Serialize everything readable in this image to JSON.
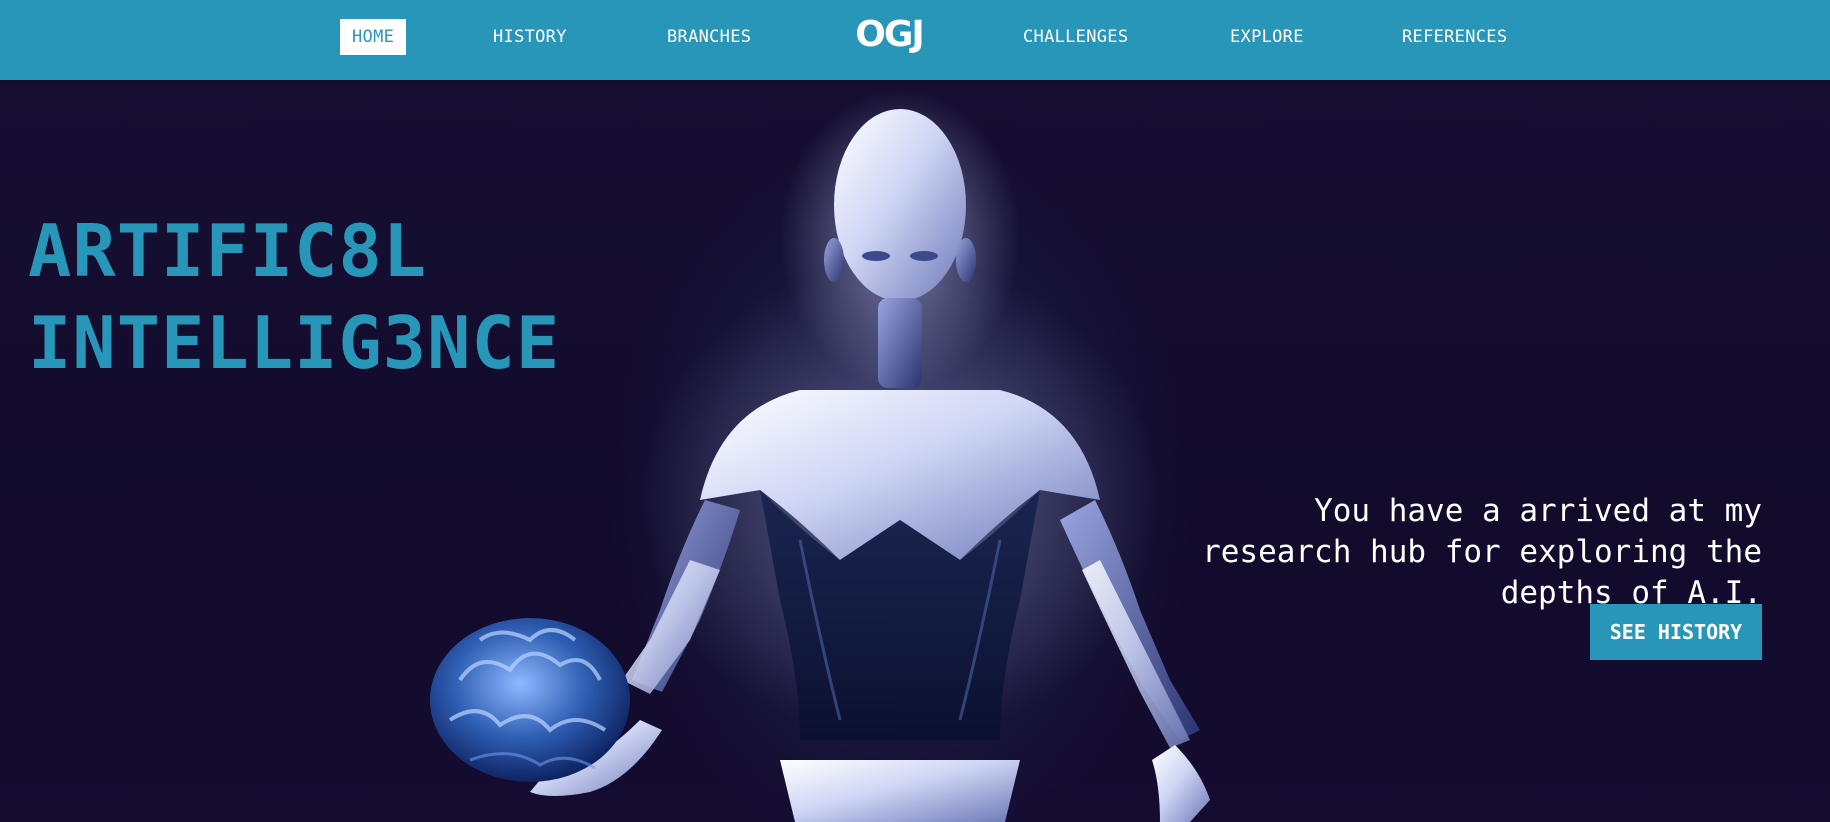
{
  "nav": {
    "items": [
      {
        "label": "HOME",
        "active": true
      },
      {
        "label": "HISTORY",
        "active": false
      },
      {
        "label": "BRANCHES",
        "active": false
      },
      {
        "label": "CHALLENGES",
        "active": false
      },
      {
        "label": "EXPLORE",
        "active": false
      },
      {
        "label": "REFERENCES",
        "active": false
      }
    ],
    "logo": "OGJ"
  },
  "hero": {
    "headline_line1": "ARTIFIC8L",
    "headline_line2": "INTELLIG3NCE",
    "tagline": "You have a arrived at my research hub for exploring the depths of A.I.",
    "cta_label": "SEE HISTORY"
  },
  "colors": {
    "accent": "#2896b8",
    "background": "#120d2e",
    "text": "#ffffff"
  }
}
